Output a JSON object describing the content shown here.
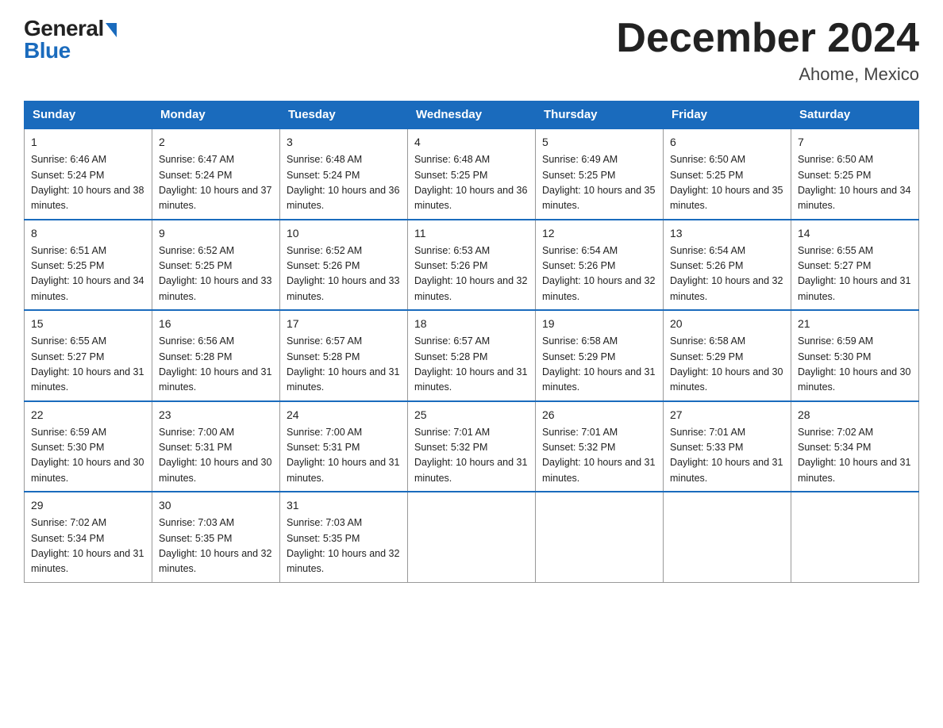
{
  "header": {
    "logo_general": "General",
    "logo_blue": "Blue",
    "month_title": "December 2024",
    "location": "Ahome, Mexico"
  },
  "days_of_week": [
    "Sunday",
    "Monday",
    "Tuesday",
    "Wednesday",
    "Thursday",
    "Friday",
    "Saturday"
  ],
  "weeks": [
    [
      {
        "day": "1",
        "sunrise": "6:46 AM",
        "sunset": "5:24 PM",
        "daylight": "10 hours and 38 minutes."
      },
      {
        "day": "2",
        "sunrise": "6:47 AM",
        "sunset": "5:24 PM",
        "daylight": "10 hours and 37 minutes."
      },
      {
        "day": "3",
        "sunrise": "6:48 AM",
        "sunset": "5:24 PM",
        "daylight": "10 hours and 36 minutes."
      },
      {
        "day": "4",
        "sunrise": "6:48 AM",
        "sunset": "5:25 PM",
        "daylight": "10 hours and 36 minutes."
      },
      {
        "day": "5",
        "sunrise": "6:49 AM",
        "sunset": "5:25 PM",
        "daylight": "10 hours and 35 minutes."
      },
      {
        "day": "6",
        "sunrise": "6:50 AM",
        "sunset": "5:25 PM",
        "daylight": "10 hours and 35 minutes."
      },
      {
        "day": "7",
        "sunrise": "6:50 AM",
        "sunset": "5:25 PM",
        "daylight": "10 hours and 34 minutes."
      }
    ],
    [
      {
        "day": "8",
        "sunrise": "6:51 AM",
        "sunset": "5:25 PM",
        "daylight": "10 hours and 34 minutes."
      },
      {
        "day": "9",
        "sunrise": "6:52 AM",
        "sunset": "5:25 PM",
        "daylight": "10 hours and 33 minutes."
      },
      {
        "day": "10",
        "sunrise": "6:52 AM",
        "sunset": "5:26 PM",
        "daylight": "10 hours and 33 minutes."
      },
      {
        "day": "11",
        "sunrise": "6:53 AM",
        "sunset": "5:26 PM",
        "daylight": "10 hours and 32 minutes."
      },
      {
        "day": "12",
        "sunrise": "6:54 AM",
        "sunset": "5:26 PM",
        "daylight": "10 hours and 32 minutes."
      },
      {
        "day": "13",
        "sunrise": "6:54 AM",
        "sunset": "5:26 PM",
        "daylight": "10 hours and 32 minutes."
      },
      {
        "day": "14",
        "sunrise": "6:55 AM",
        "sunset": "5:27 PM",
        "daylight": "10 hours and 31 minutes."
      }
    ],
    [
      {
        "day": "15",
        "sunrise": "6:55 AM",
        "sunset": "5:27 PM",
        "daylight": "10 hours and 31 minutes."
      },
      {
        "day": "16",
        "sunrise": "6:56 AM",
        "sunset": "5:28 PM",
        "daylight": "10 hours and 31 minutes."
      },
      {
        "day": "17",
        "sunrise": "6:57 AM",
        "sunset": "5:28 PM",
        "daylight": "10 hours and 31 minutes."
      },
      {
        "day": "18",
        "sunrise": "6:57 AM",
        "sunset": "5:28 PM",
        "daylight": "10 hours and 31 minutes."
      },
      {
        "day": "19",
        "sunrise": "6:58 AM",
        "sunset": "5:29 PM",
        "daylight": "10 hours and 31 minutes."
      },
      {
        "day": "20",
        "sunrise": "6:58 AM",
        "sunset": "5:29 PM",
        "daylight": "10 hours and 30 minutes."
      },
      {
        "day": "21",
        "sunrise": "6:59 AM",
        "sunset": "5:30 PM",
        "daylight": "10 hours and 30 minutes."
      }
    ],
    [
      {
        "day": "22",
        "sunrise": "6:59 AM",
        "sunset": "5:30 PM",
        "daylight": "10 hours and 30 minutes."
      },
      {
        "day": "23",
        "sunrise": "7:00 AM",
        "sunset": "5:31 PM",
        "daylight": "10 hours and 30 minutes."
      },
      {
        "day": "24",
        "sunrise": "7:00 AM",
        "sunset": "5:31 PM",
        "daylight": "10 hours and 31 minutes."
      },
      {
        "day": "25",
        "sunrise": "7:01 AM",
        "sunset": "5:32 PM",
        "daylight": "10 hours and 31 minutes."
      },
      {
        "day": "26",
        "sunrise": "7:01 AM",
        "sunset": "5:32 PM",
        "daylight": "10 hours and 31 minutes."
      },
      {
        "day": "27",
        "sunrise": "7:01 AM",
        "sunset": "5:33 PM",
        "daylight": "10 hours and 31 minutes."
      },
      {
        "day": "28",
        "sunrise": "7:02 AM",
        "sunset": "5:34 PM",
        "daylight": "10 hours and 31 minutes."
      }
    ],
    [
      {
        "day": "29",
        "sunrise": "7:02 AM",
        "sunset": "5:34 PM",
        "daylight": "10 hours and 31 minutes."
      },
      {
        "day": "30",
        "sunrise": "7:03 AM",
        "sunset": "5:35 PM",
        "daylight": "10 hours and 32 minutes."
      },
      {
        "day": "31",
        "sunrise": "7:03 AM",
        "sunset": "5:35 PM",
        "daylight": "10 hours and 32 minutes."
      },
      null,
      null,
      null,
      null
    ]
  ]
}
